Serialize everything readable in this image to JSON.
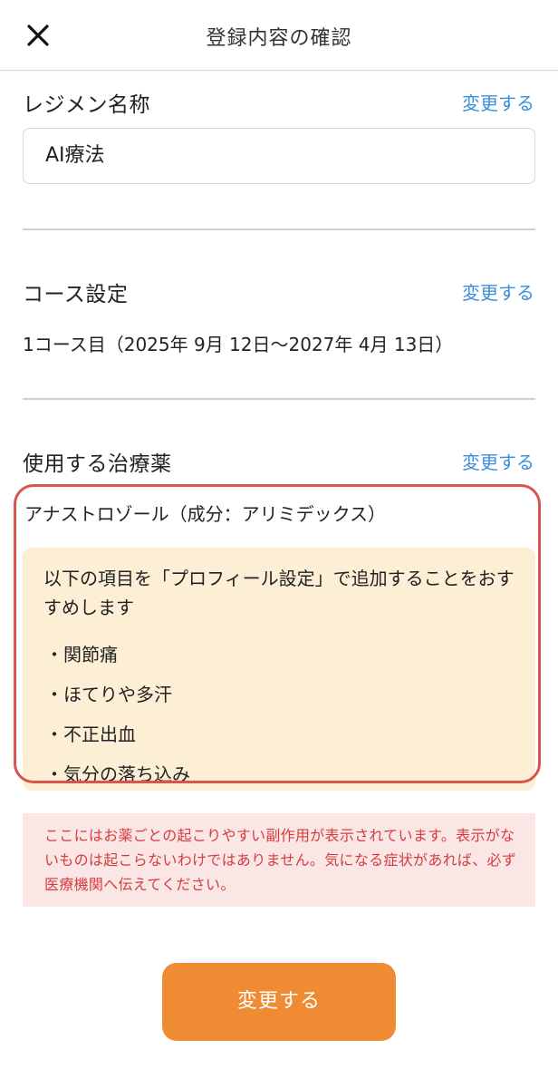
{
  "header": {
    "title": "登録内容の確認",
    "close_icon": "close-icon"
  },
  "regimen": {
    "heading": "レジメン名称",
    "change_label": "変更する",
    "value": "AI療法"
  },
  "course": {
    "heading": "コース設定",
    "change_label": "変更する",
    "value": "1コース目（2025年 9月 12日〜2027年 4月 13日）"
  },
  "medication": {
    "heading": "使用する治療薬",
    "change_label": "変更する",
    "drug_name": "アナストロゾール（成分：アリミデックス）",
    "recommendation": {
      "text": "以下の項目を「プロフィール設定」で追加することをおすすめします",
      "symptoms": [
        "関節痛",
        "ほてりや多汗",
        "不正出血",
        "気分の落ち込み"
      ]
    }
  },
  "notice": {
    "text": "ここにはお薬ごとの起こりやすい副作用が表示されています。表示がないものは起こらないわけではありません。気になる症状があれば、必ず医療機関へ伝えてください。"
  },
  "submit_button": {
    "label": "変更する"
  },
  "colors": {
    "accent_button": "#ef8b33",
    "link": "#3b8fd8",
    "highlight_frame": "#d9534f",
    "recommend_bg": "#fcefd6",
    "notice_bg": "#fbe6e6",
    "notice_text": "#d43d3d"
  }
}
